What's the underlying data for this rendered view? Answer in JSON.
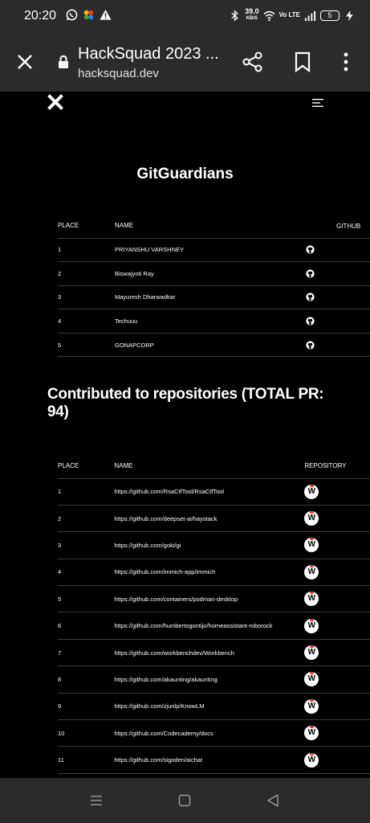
{
  "status_bar": {
    "time": "20:20",
    "net_speed_value": "39.0",
    "net_speed_unit": "KB/S",
    "volte": "Vo LTE",
    "battery": "5",
    "icons": [
      "whatsapp-icon",
      "photos-icon",
      "warning-icon",
      "bluetooth-icon",
      "wifi-icon",
      "signal-icon",
      "charging-icon"
    ]
  },
  "browser": {
    "title": "HackSquad 2023 ...",
    "url": "hacksquad.dev",
    "icons": [
      "close-icon",
      "lock-icon",
      "share-icon",
      "bookmark-icon",
      "more-icon"
    ]
  },
  "site": {
    "logo": "x-logo-icon",
    "menu": "hamburger-icon"
  },
  "team": {
    "name": "GitGuardians",
    "headers": {
      "place": "PLACE",
      "name": "NAME",
      "github": "GITHUB"
    },
    "members": [
      {
        "place": "1",
        "name": "PRIYANSHU VARSHNEY"
      },
      {
        "place": "2",
        "name": "Biswajyoti Ray"
      },
      {
        "place": "3",
        "name": "Mayuresh Dharwadkar"
      },
      {
        "place": "4",
        "name": "Techuuu"
      },
      {
        "place": "5",
        "name": "GONAPCORP"
      }
    ]
  },
  "repos": {
    "title": "Contributed to repositories (TOTAL PR: 94)",
    "headers": {
      "place": "PLACE",
      "name": "NAME",
      "repository": "REPOSITORY"
    },
    "items": [
      {
        "place": "1",
        "name": "https://github.com/RsaCtfTool/RsaCtfTool"
      },
      {
        "place": "2",
        "name": "https://github.com/deepset-ai/haystack"
      },
      {
        "place": "3",
        "name": "https://github.com/goki/gi"
      },
      {
        "place": "4",
        "name": "https://github.com/immich-app/immich"
      },
      {
        "place": "5",
        "name": "https://github.com/containers/podman-desktop"
      },
      {
        "place": "6",
        "name": "https://github.com/humbertogontijo/homeassistant-roborock"
      },
      {
        "place": "7",
        "name": "https://github.com/workbenchdev/Workbench"
      },
      {
        "place": "8",
        "name": "https://github.com/akaunting/akaunting"
      },
      {
        "place": "9",
        "name": "https://github.com/zjunlp/KnowLM"
      },
      {
        "place": "10",
        "name": "https://github.com/Codecademy/docs"
      },
      {
        "place": "11",
        "name": "https://github.com/sigoden/aichat"
      }
    ],
    "repo_icon_letter": "W"
  },
  "nav": {
    "icons": [
      "recent-apps-icon",
      "home-icon",
      "back-icon"
    ]
  }
}
